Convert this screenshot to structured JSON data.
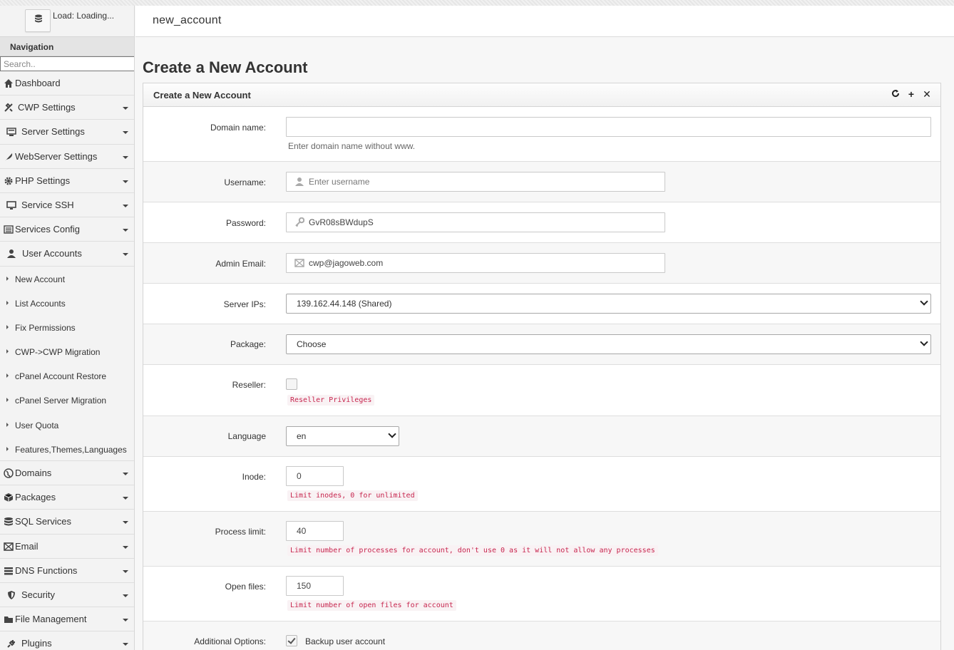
{
  "sidebar": {
    "load_label": "Load: Loading...",
    "nav_title": "Navigation",
    "search_placeholder": "Search..",
    "items": [
      {
        "label": "Dashboard",
        "icon": "home-icon",
        "caret": false
      },
      {
        "label": "CWP Settings",
        "icon": "tools-icon",
        "caret": true
      },
      {
        "label": "Server Settings",
        "icon": "server-icon",
        "caret": true
      },
      {
        "label": "WebServer Settings",
        "icon": "feather-icon",
        "caret": true
      },
      {
        "label": "PHP Settings",
        "icon": "gear-icon",
        "caret": true
      },
      {
        "label": "Service SSH",
        "icon": "monitor-icon",
        "caret": true
      },
      {
        "label": "Services Config",
        "icon": "list-icon",
        "caret": true
      },
      {
        "label": "User Accounts",
        "icon": "user-icon",
        "caret": true
      }
    ],
    "sub_items": [
      "New Account",
      "List Accounts",
      "Fix Permissions",
      "CWP->CWP Migration",
      "cPanel Account Restore",
      "cPanel Server Migration",
      "User Quota",
      "Features,Themes,Languages"
    ],
    "items_after": [
      {
        "label": "Domains",
        "icon": "globe-icon"
      },
      {
        "label": "Packages",
        "icon": "box-icon"
      },
      {
        "label": "SQL Services",
        "icon": "database-icon"
      },
      {
        "label": "Email",
        "icon": "envelope-icon"
      },
      {
        "label": "DNS Functions",
        "icon": "dns-icon"
      },
      {
        "label": "Security",
        "icon": "shield-icon"
      },
      {
        "label": "File Management",
        "icon": "folder-icon"
      },
      {
        "label": "Plugins",
        "icon": "plug-icon"
      }
    ]
  },
  "header": {
    "title": "new_account"
  },
  "main": {
    "page_title": "Create a New Account",
    "panel_title": "Create a New Account",
    "form": {
      "domain": {
        "label": "Domain name:",
        "value": "",
        "help": "Enter domain name without www."
      },
      "username": {
        "label": "Username:",
        "placeholder": "Enter username"
      },
      "password": {
        "label": "Password:",
        "value": "GvR08sBWdupS"
      },
      "email": {
        "label": "Admin Email:",
        "value": "cwp@jagoweb.com"
      },
      "server_ips": {
        "label": "Server IPs:",
        "selected": "139.162.44.148 (Shared)"
      },
      "package": {
        "label": "Package:",
        "selected": "Choose"
      },
      "reseller": {
        "label": "Reseller:",
        "checked": false,
        "help": "Reseller Privileges"
      },
      "language": {
        "label": "Language",
        "selected": "en"
      },
      "inode": {
        "label": "Inode:",
        "value": "0",
        "help": "Limit inodes, 0 for unlimited"
      },
      "process_limit": {
        "label": "Process limit:",
        "value": "40",
        "help": "Limit number of processes for account, don't use 0 as it will not allow any processes"
      },
      "open_files": {
        "label": "Open files:",
        "value": "150",
        "help": "Limit number of open files for account"
      },
      "additional": {
        "label": "Additional Options:",
        "backup_checked": true,
        "backup_label": "Backup user account"
      }
    }
  },
  "colors": {
    "code_text": "#c7254e",
    "code_bg": "#f9f2f4"
  }
}
